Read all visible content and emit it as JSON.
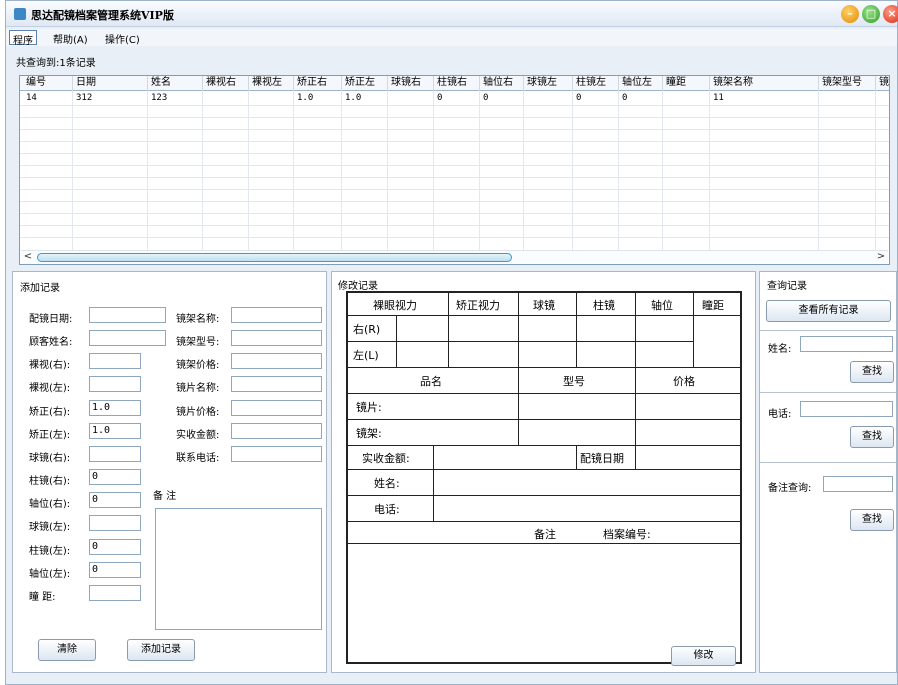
{
  "window": {
    "title": "思达配镜档案管理系统VIP版"
  },
  "menu": [
    "程序",
    "帮助(A)",
    "操作(C)"
  ],
  "status": {
    "count_text": "共查询到:1条记录"
  },
  "grid": {
    "columns": [
      "编号",
      "日期",
      "姓名",
      "裸视右",
      "裸视左",
      "矫正右",
      "矫正左",
      "球镜右",
      "柱镜右",
      "轴位右",
      "球镜左",
      "柱镜左",
      "轴位左",
      "瞳距",
      "镜架名称",
      "镜架型号",
      "镜"
    ],
    "rows": [
      [
        "14",
        "312",
        "123",
        "",
        "",
        "1.0",
        "1.0",
        "",
        "0",
        "0",
        "",
        "0",
        "0",
        "",
        "11",
        "",
        ""
      ]
    ]
  },
  "scroll": {
    "left_arrow": "<",
    "right_arrow": ">"
  },
  "add_record": {
    "title": "添加记录",
    "left_fields": [
      {
        "label": "配镜日期:",
        "value": ""
      },
      {
        "label": "顾客姓名:",
        "value": ""
      },
      {
        "label": "裸视(右):",
        "value": ""
      },
      {
        "label": "裸视(左):",
        "value": ""
      },
      {
        "label": "矫正(右):",
        "value": "1.0"
      },
      {
        "label": "矫正(左):",
        "value": "1.0"
      },
      {
        "label": "球镜(右):",
        "value": ""
      },
      {
        "label": "柱镜(右):",
        "value": "0"
      },
      {
        "label": "轴位(右):",
        "value": "0"
      },
      {
        "label": "球镜(左):",
        "value": ""
      },
      {
        "label": "柱镜(左):",
        "value": "0"
      },
      {
        "label": "轴位(左):",
        "value": "0"
      },
      {
        "label": "瞳  距:",
        "value": ""
      }
    ],
    "right_fields": [
      {
        "label": "镜架名称:",
        "value": ""
      },
      {
        "label": "镜架型号:",
        "value": ""
      },
      {
        "label": "镜架价格:",
        "value": ""
      },
      {
        "label": "镜片名称:",
        "value": ""
      },
      {
        "label": "镜片价格:",
        "value": ""
      },
      {
        "label": "实收金额:",
        "value": ""
      },
      {
        "label": "联系电话:",
        "value": ""
      }
    ],
    "notes_label": "备  注",
    "clear_button": "清除",
    "add_button": "添加记录"
  },
  "modify_record": {
    "title": "修改记录",
    "h_naked": "裸眼视力",
    "h_corr": "矫正视力",
    "h_sph": "球镜",
    "h_cyl": "柱镜",
    "h_axis": "轴位",
    "h_pd": "瞳距",
    "row_r": "右(R)",
    "row_l": "左(L)",
    "h_name": "品名",
    "h_model": "型号",
    "h_price": "价格",
    "lens": "镜片:",
    "frame": "镜架:",
    "paid": "实收金额:",
    "date": "配镜日期",
    "name": "姓名:",
    "phone": "电话:",
    "notes": "备注",
    "archive": "档案编号:",
    "button": "修改"
  },
  "query": {
    "title": "查询记录",
    "all_button": "查看所有记录",
    "name_label": "姓名:",
    "name_value": "",
    "phone_label": "电话:",
    "phone_value": "",
    "notes_label": "备注查询:",
    "notes_value": "",
    "find": "查找"
  }
}
